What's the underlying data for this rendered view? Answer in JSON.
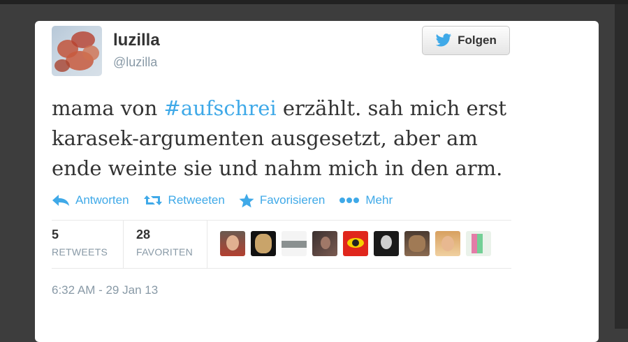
{
  "user": {
    "name": "luzilla",
    "handle": "@luzilla"
  },
  "follow_button": {
    "label": "Folgen"
  },
  "tweet": {
    "text_before": "mama von ",
    "hashtag": "#aufschrei",
    "text_after": " erzählt. sah mich erst karasek-argumenten ausgesetzt, aber am ende weinte sie und nahm mich in den arm."
  },
  "actions": [
    {
      "label": "Antworten",
      "icon": "reply-icon"
    },
    {
      "label": "Retweeten",
      "icon": "retweet-icon"
    },
    {
      "label": "Favorisieren",
      "icon": "star-icon"
    },
    {
      "label": "Mehr",
      "icon": "more-icon"
    }
  ],
  "stats": {
    "retweets": {
      "count": "5",
      "label": "RETWEETS"
    },
    "favorites": {
      "count": "28",
      "label": "FAVORITEN"
    }
  },
  "timestamp": "6:32 AM - 29 Jan 13",
  "colors": {
    "accent": "#3fa9e8",
    "text": "#333333",
    "muted": "#8899a6"
  }
}
